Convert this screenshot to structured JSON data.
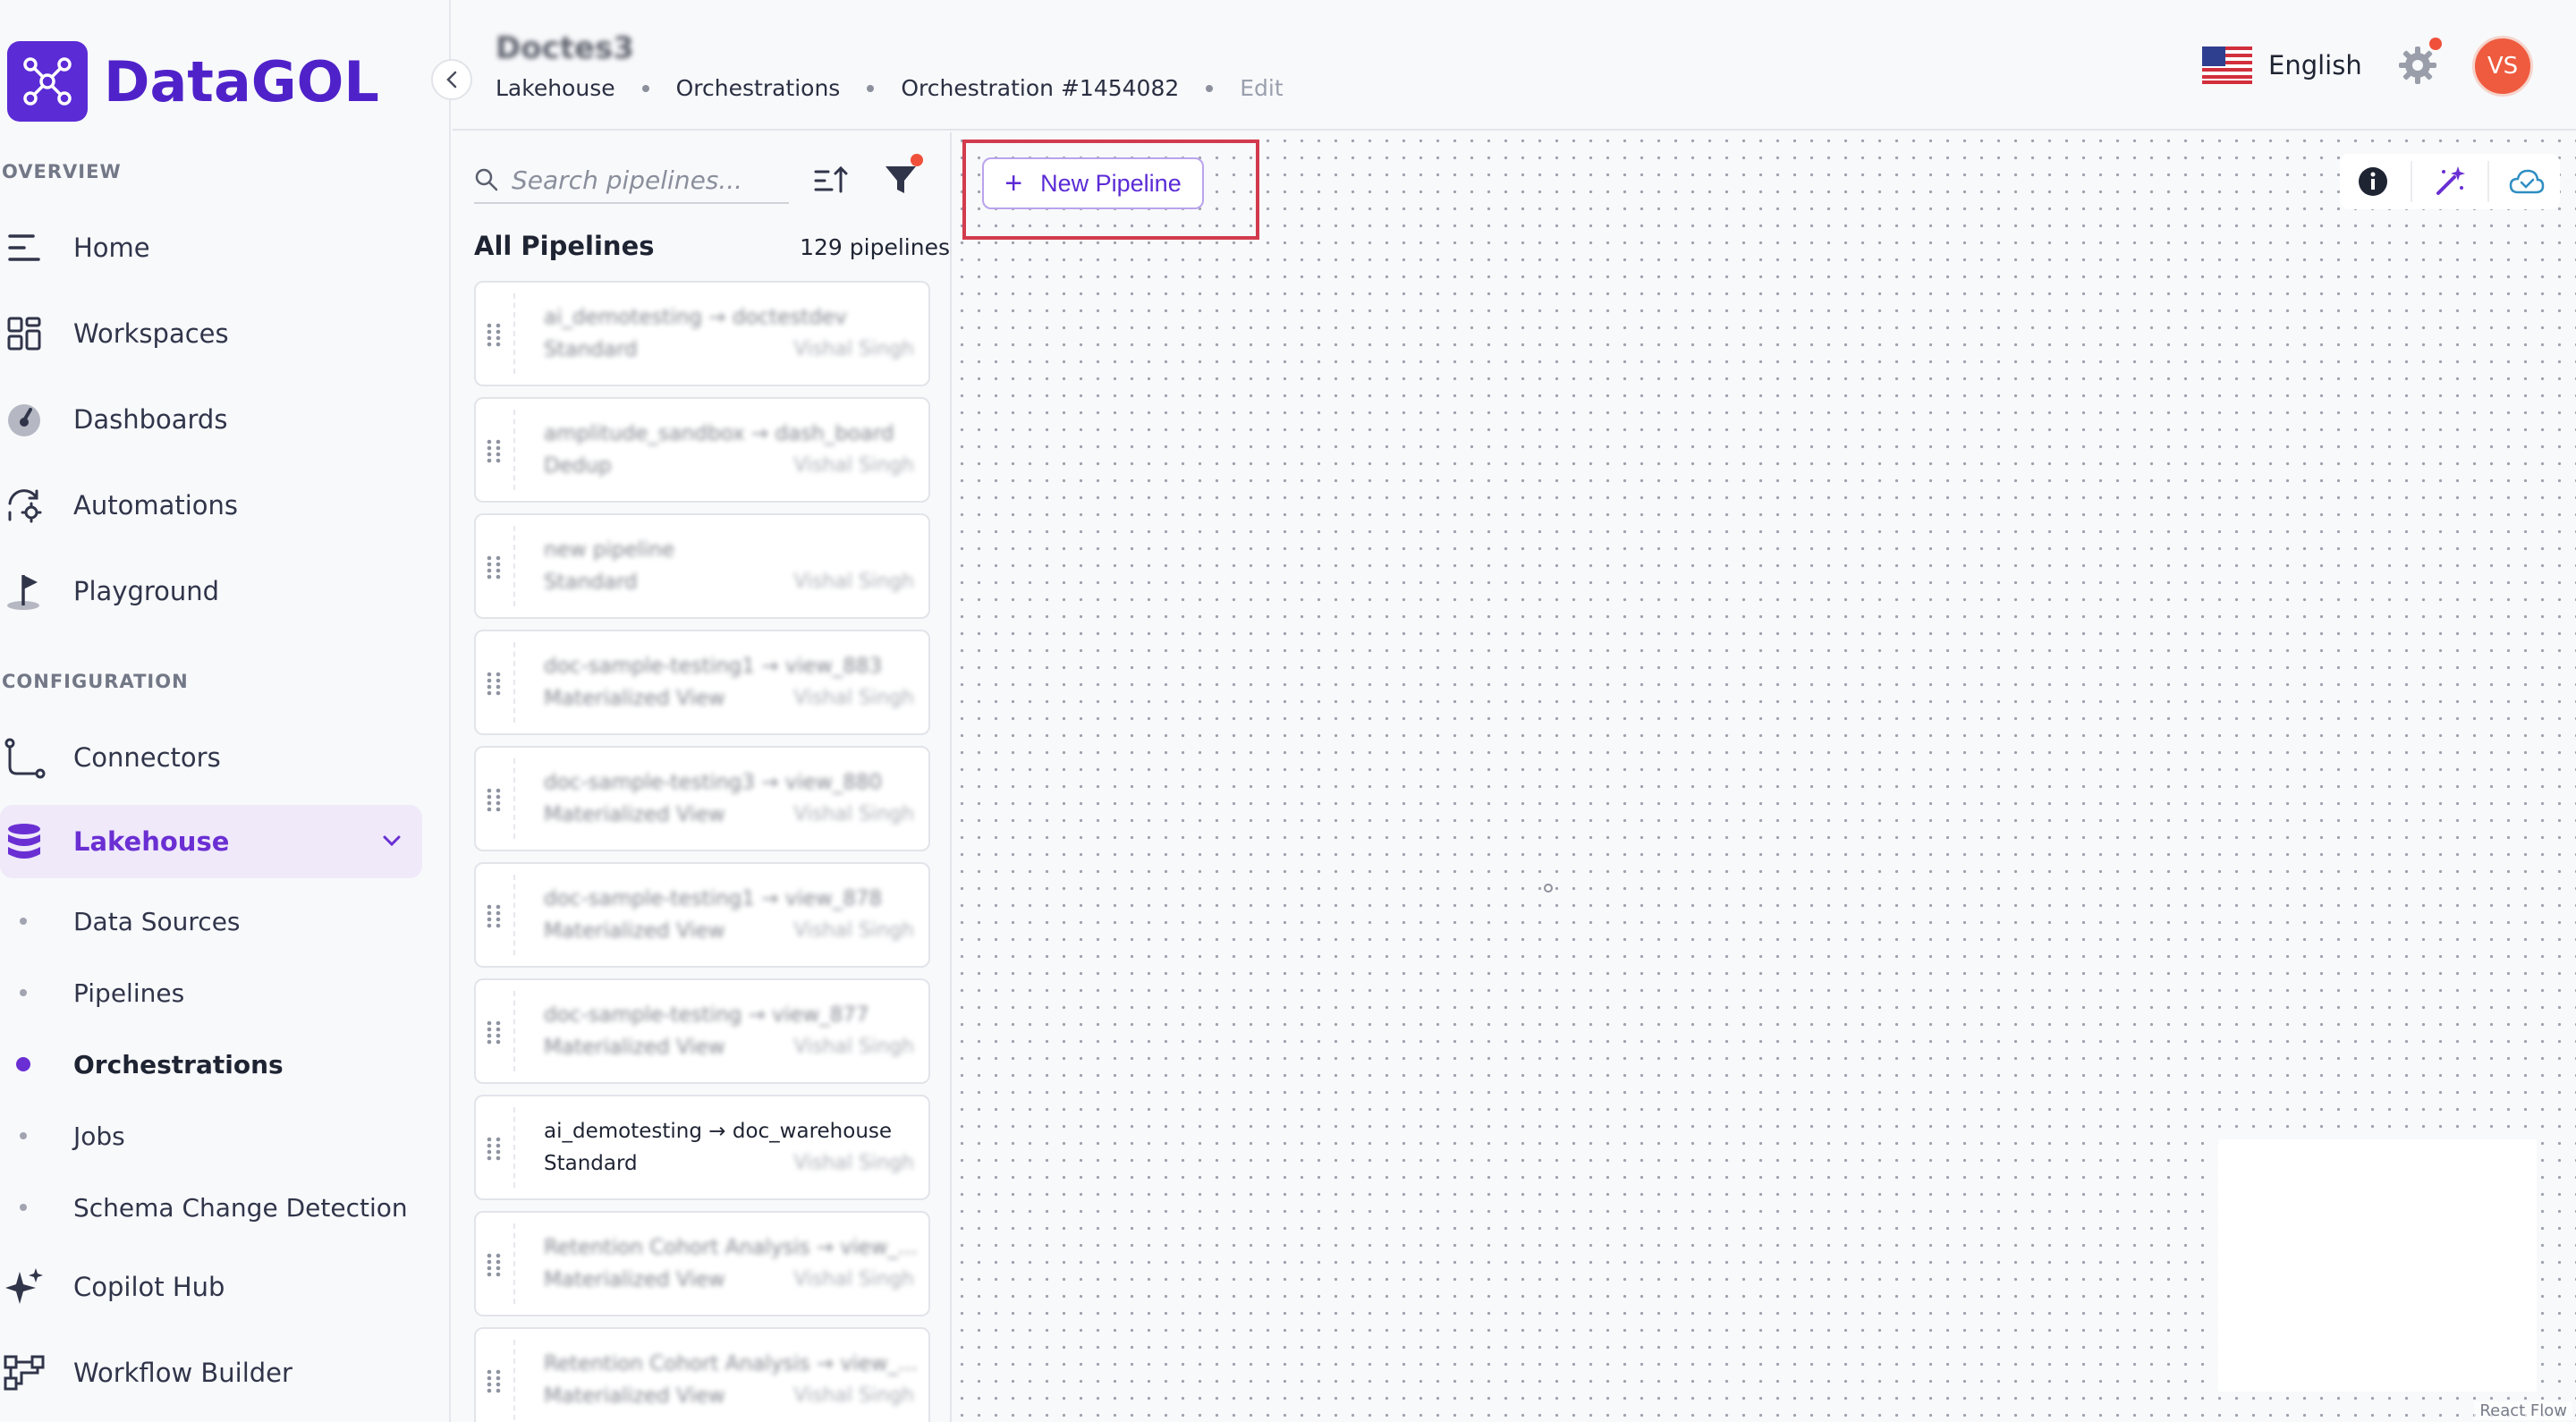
{
  "app": {
    "brand": "DataGOL"
  },
  "sidebar": {
    "overview_label": "OVERVIEW",
    "configuration_label": "CONFIGURATION",
    "overview_items": [
      {
        "label": "Home",
        "icon": "menu-lines-icon"
      },
      {
        "label": "Workspaces",
        "icon": "grid-icon"
      },
      {
        "label": "Dashboards",
        "icon": "gauge-icon"
      },
      {
        "label": "Automations",
        "icon": "refresh-gear-icon"
      },
      {
        "label": "Playground",
        "icon": "flag-icon"
      }
    ],
    "config_items": [
      {
        "label": "Connectors",
        "icon": "connector-icon"
      },
      {
        "label": "Lakehouse",
        "icon": "database-icon",
        "expanded": true
      }
    ],
    "lakehouse_sub": [
      {
        "label": "Data Sources"
      },
      {
        "label": "Pipelines"
      },
      {
        "label": "Orchestrations",
        "current": true
      },
      {
        "label": "Jobs"
      },
      {
        "label": "Schema Change Detection"
      }
    ],
    "bottom_items": [
      {
        "label": "Copilot Hub",
        "icon": "sparkles-icon"
      },
      {
        "label": "Workflow Builder",
        "icon": "workflow-icon"
      }
    ],
    "accent_color": "#6a2fd3"
  },
  "header": {
    "title": "Doctes3",
    "breadcrumbs": [
      "Lakehouse",
      "Orchestrations",
      "Orchestration #1454082",
      "Edit"
    ],
    "language": "English",
    "user_initials": "VS"
  },
  "pipelines_panel": {
    "search_placeholder": "Search pipelines...",
    "list_title": "All Pipelines",
    "count_label": "129 pipelines",
    "items": [
      {
        "title": "ai_demotesting → doctestdev",
        "type": "Standard",
        "owner": "Vishal Singh",
        "blurred": true
      },
      {
        "title": "amplitude_sandbox → dash_board",
        "type": "Dedup",
        "owner": "Vishal Singh",
        "blurred": true
      },
      {
        "title": "new pipeline",
        "type": "Standard",
        "owner": "Vishal Singh",
        "blurred": true
      },
      {
        "title": "doc-sample-testing1 → view_883",
        "type": "Materialized View",
        "owner": "Vishal Singh",
        "blurred": true
      },
      {
        "title": "doc-sample-testing3 → view_880",
        "type": "Materialized View",
        "owner": "Vishal Singh",
        "blurred": true
      },
      {
        "title": "doc-sample-testing1 → view_878",
        "type": "Materialized View",
        "owner": "Vishal Singh",
        "blurred": true
      },
      {
        "title": "doc-sample-testing → view_877",
        "type": "Materialized View",
        "owner": "Vishal Singh",
        "blurred": true
      },
      {
        "title": "ai_demotesting → doc_warehouse",
        "type": "Standard",
        "owner": "Vishal Singh",
        "blurred": false
      },
      {
        "title": "Retention Cohort Analysis → view_...",
        "type": "Materialized View",
        "owner": "Vishal Singh",
        "blurred": true
      },
      {
        "title": "Retention Cohort Analysis → view_...",
        "type": "Materialized View",
        "owner": "Vishal Singh",
        "blurred": true
      }
    ]
  },
  "canvas": {
    "new_pipeline_label": "New Pipeline",
    "toolbar_icons": [
      "info-icon",
      "magic-wand-icon",
      "cloud-check-icon"
    ],
    "attribution": "React Flow"
  }
}
